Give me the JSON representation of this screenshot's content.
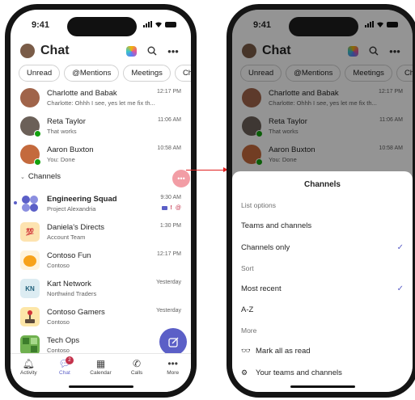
{
  "status": {
    "time": "9:41"
  },
  "header": {
    "title": "Chat"
  },
  "filters": [
    "Unread",
    "@Mentions",
    "Meetings",
    "Chats"
  ],
  "chats": [
    {
      "name": "Charlotte and Babak",
      "preview": "Charlotte: Ohhh I see, yes let me fix th...",
      "time": "12:17 PM",
      "avatar_color": "#a0644a"
    },
    {
      "name": "Reta Taylor",
      "preview": "That works",
      "time": "11:06 AM",
      "avatar_color": "#6b6058"
    },
    {
      "name": "Aaron Buxton",
      "preview": "You: Done",
      "time": "10:58 AM",
      "avatar_color": "#c46a3d"
    }
  ],
  "channels_section": {
    "label": "Channels",
    "more": "•••"
  },
  "channels": [
    {
      "name": "Engineering Squad",
      "preview": "Project Alexandria",
      "time": "9:30 AM",
      "icon": "grid-dots-icon",
      "color": "#5b5fc7"
    },
    {
      "name": "Daniela's Directs",
      "preview": "Account Team",
      "time": "1:30 PM",
      "icon": "100-emoji-icon",
      "color": "#fde3b0"
    },
    {
      "name": "Contoso Fun",
      "preview": "Contoso",
      "time": "12:17 PM",
      "icon": "orange-blob-icon",
      "color": "#fff3dc"
    },
    {
      "name": "Kart Network",
      "preview": "Northwind Traders",
      "time": "Yesterday",
      "icon": "kn-initials",
      "initials": "KN",
      "color": "#dcecf2"
    },
    {
      "name": "Contoso Gamers",
      "preview": "Contoso",
      "time": "Yesterday",
      "icon": "joystick-icon",
      "color": "#fde6a8"
    },
    {
      "name": "Tech Ops",
      "preview": "Contoso",
      "time": "",
      "icon": "pixel-grid-icon",
      "color": "#6fb04f"
    }
  ],
  "tabs": [
    {
      "label": "Activity",
      "icon": "bell-icon",
      "glyph": "🔔︎"
    },
    {
      "label": "Chat",
      "icon": "chat-icon",
      "glyph": "💬︎",
      "badge": "2"
    },
    {
      "label": "Calendar",
      "icon": "calendar-icon",
      "glyph": "▦"
    },
    {
      "label": "Calls",
      "icon": "phone-icon",
      "glyph": "✆"
    },
    {
      "label": "More",
      "icon": "more-icon",
      "glyph": "•••"
    }
  ],
  "sheet": {
    "title": "Channels",
    "list_options_label": "List options",
    "teams_and_channels": "Teams and channels",
    "channels_only": "Channels only",
    "sort_label": "Sort",
    "most_recent": "Most recent",
    "a_z": "A-Z",
    "more_label": "More",
    "mark_all_read": "Mark all as read",
    "your_teams": "Your teams and channels"
  },
  "colors": {
    "brand": "#5b5fc7",
    "annotation": "#e02020",
    "presence_available": "#13a10e"
  }
}
